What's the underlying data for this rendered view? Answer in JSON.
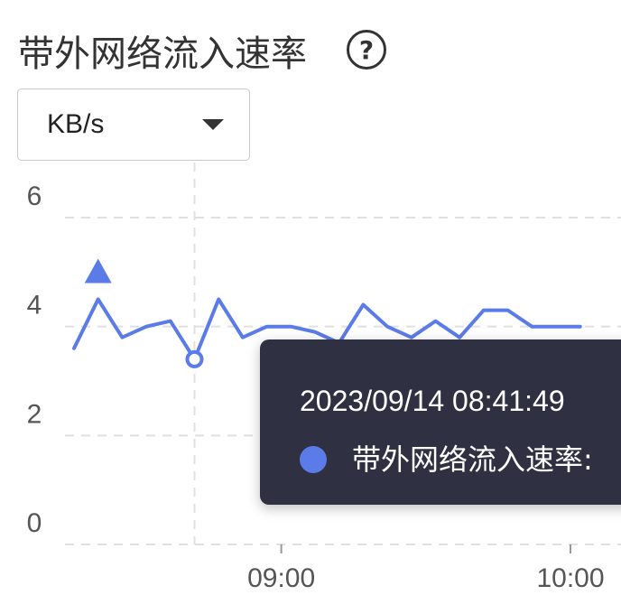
{
  "panel": {
    "title": "带外网络流入速率",
    "help_icon": "question-circle-icon",
    "unit_selector": {
      "selected": "KB/s",
      "icon": "caret-down-icon"
    }
  },
  "colors": {
    "series": "#5b7be9",
    "tooltip_bg": "#2f3143",
    "grid": "#e0e0e0"
  },
  "tooltip": {
    "time": "2023/09/14 08:41:49",
    "series_name": "带外网络流入速率:"
  },
  "chart_data": {
    "type": "line",
    "x": [
      "08:17",
      "08:22",
      "08:27",
      "08:32",
      "08:37",
      "08:42",
      "08:47",
      "08:52",
      "08:57",
      "09:02",
      "09:07",
      "09:12",
      "09:17",
      "09:22",
      "09:27",
      "09:32",
      "09:37",
      "09:42",
      "09:47",
      "09:52",
      "09:57",
      "10:02"
    ],
    "series": [
      {
        "name": "带外网络流入速率",
        "values": [
          3.6,
          4.5,
          3.8,
          4.0,
          4.1,
          3.4,
          4.5,
          3.8,
          4.0,
          4.0,
          3.9,
          3.7,
          4.4,
          4.0,
          3.8,
          4.1,
          3.8,
          4.3,
          4.3,
          4.0,
          4.0,
          4.0
        ]
      }
    ],
    "x_ticks": [
      "09:00",
      "10:00"
    ],
    "y_ticks": [
      "0",
      "2",
      "4",
      "6"
    ],
    "ylim": [
      0,
      6
    ],
    "highlight_index": 5,
    "peak_marker_index": 1,
    "grid": true
  }
}
